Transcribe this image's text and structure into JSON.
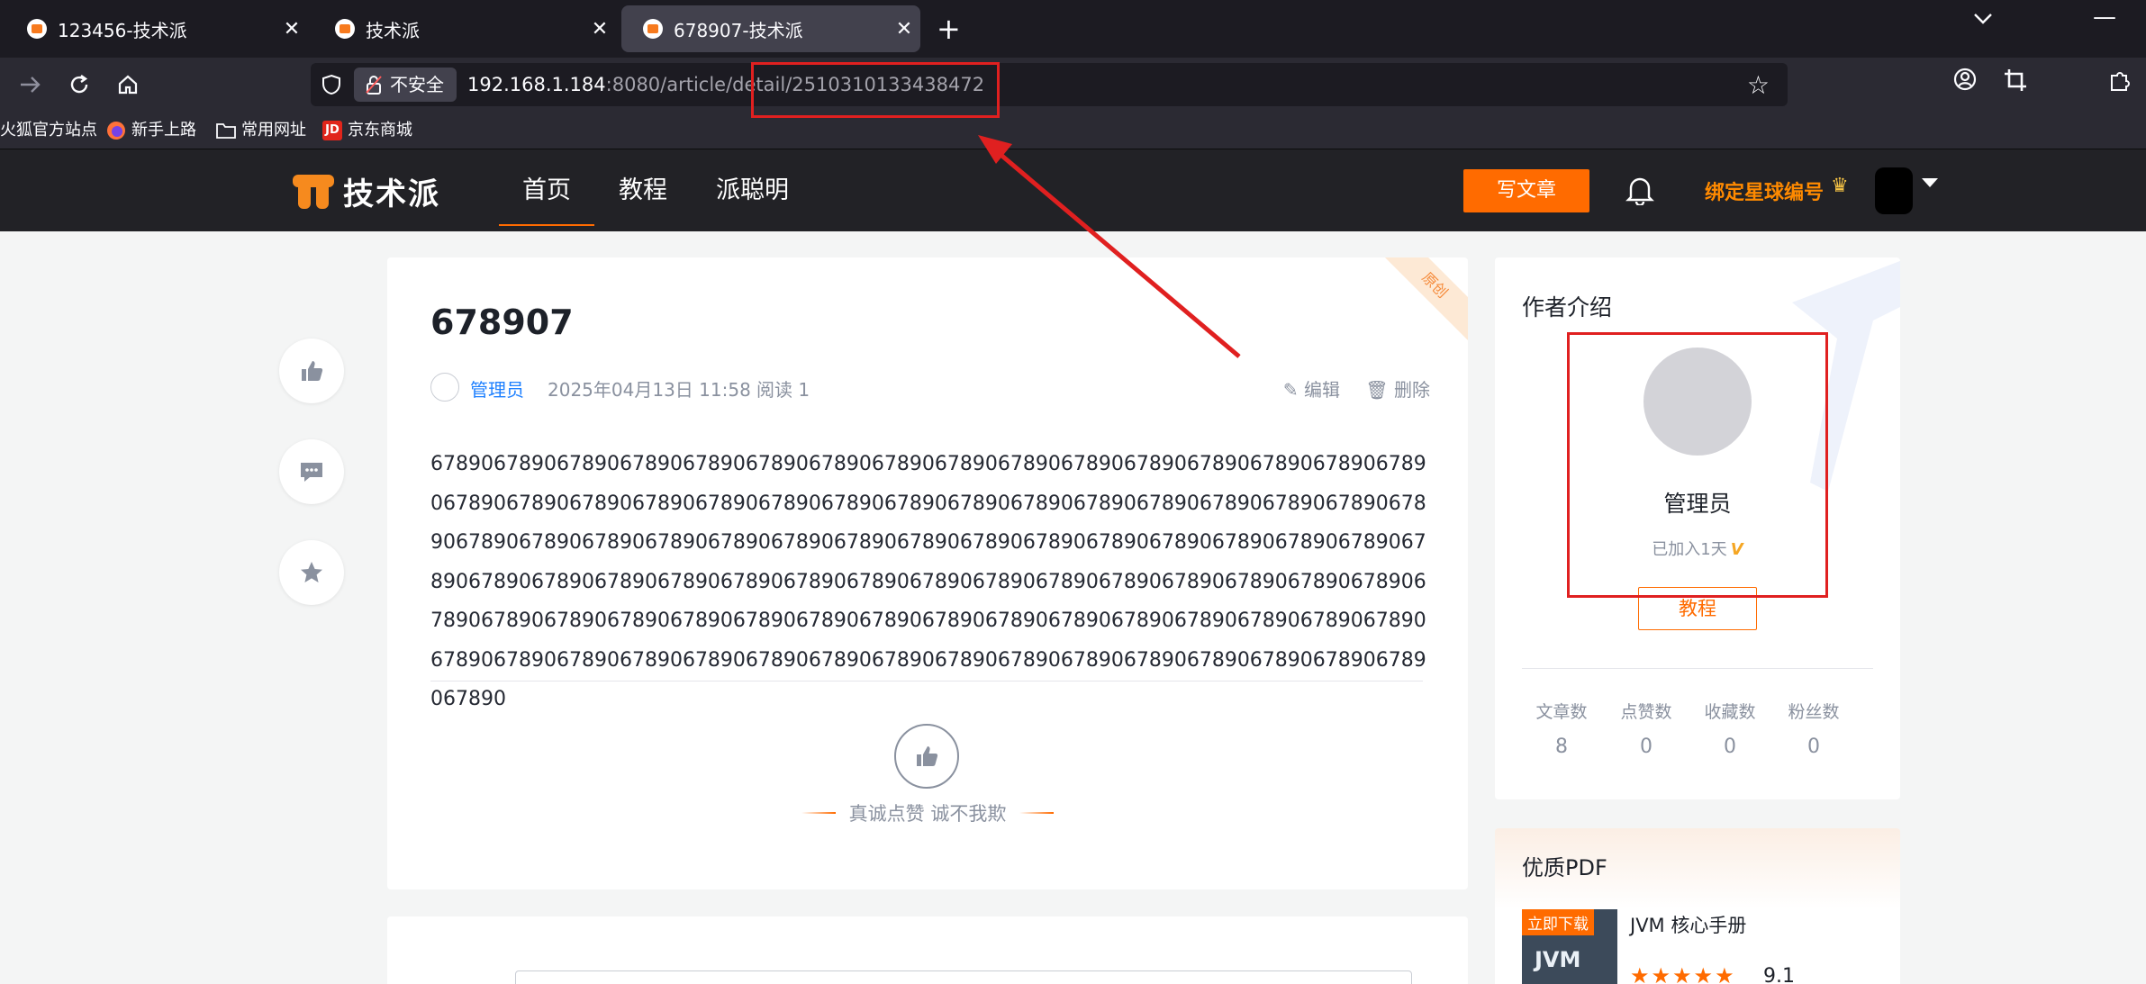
{
  "browser": {
    "tabs": [
      {
        "title": "123456-技术派",
        "active": false
      },
      {
        "title": "技术派",
        "active": false
      },
      {
        "title": "678907-技术派",
        "active": true
      }
    ],
    "new_tab": "+",
    "close_glyph": "✕",
    "security_label": "不安全",
    "url_host": "192.168.1.184",
    "url_rest": ":8080/article/detail/2510310133438472",
    "bookmarks": [
      "火狐官方站点",
      "新手上路",
      "常用网址",
      "京东商城"
    ],
    "jd_icon_text": "JD"
  },
  "header": {
    "logo_text": "技术派",
    "nav": [
      "首页",
      "教程",
      "派聪明"
    ],
    "write_button": "写文章",
    "bind_star": "绑定星球编号",
    "accent": "#ff6b00"
  },
  "article": {
    "ribbon": "原创",
    "title": "678907",
    "author": "管理员",
    "date": "2025年04月13日 11:58",
    "reads": "阅读 1",
    "edit": "编辑",
    "delete": "删除",
    "body": "678906789067890678906789067890678906789067890678906789067890678906789067890678906789067890678906789067890678906789067890678906789067890678906789067890678906789067890678906789067890678906789067890678906789067890678906789067890678906789067890678906789067890678906789067890678906789067890678906789067890678906789067890678906789067890678906789067890678906789067890678906789067890678906789067890678906789067890678906789067890678906789067890678906789067890678906789067890678906789067890",
    "slogan": "真诚点赞 诚不我欺"
  },
  "author_card": {
    "heading": "作者介绍",
    "name": "管理员",
    "joined": "已加入1天",
    "level": "V",
    "tutorial_button": "教程",
    "stats": [
      {
        "label": "文章数",
        "value": "8"
      },
      {
        "label": "点赞数",
        "value": "0"
      },
      {
        "label": "收藏数",
        "value": "0"
      },
      {
        "label": "粉丝数",
        "value": "0"
      }
    ]
  },
  "pdf_card": {
    "heading": "优质PDF",
    "tag": "立即下载",
    "cover_text": "JVM",
    "name": "JVM 核心手册",
    "stars": "★★★★★",
    "score": "9.1"
  }
}
